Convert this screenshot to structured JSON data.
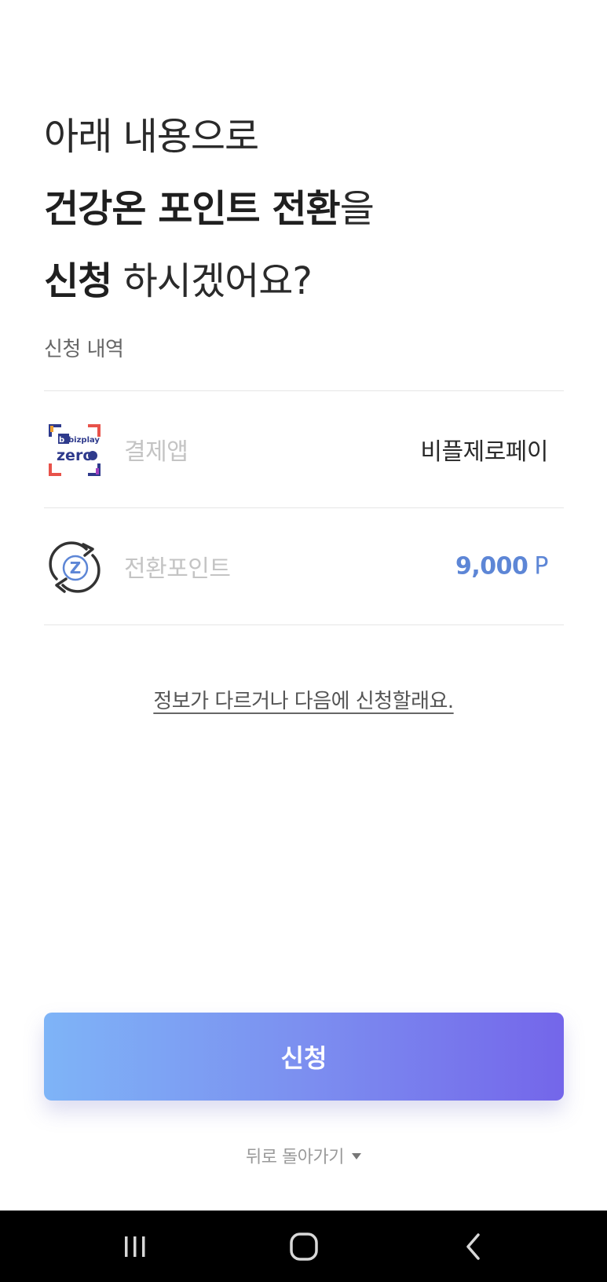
{
  "header": {
    "line1": "아래 내용으로",
    "line2_bold": "건강온 포인트 전환",
    "line2_suffix": "을",
    "line3_bold": "신청",
    "line3_suffix": " 하시겠어요?"
  },
  "details": {
    "section_label": "신청 내역",
    "rows": [
      {
        "label": "결제앱",
        "value": "비플제로페이",
        "icon": "bizplay-zero-logo-icon"
      },
      {
        "label": "전환포인트",
        "value": "9,000",
        "unit": "P",
        "icon": "point-exchange-icon"
      }
    ]
  },
  "alt_link": "정보가 다르거나 다음에 신청할래요.",
  "primary_button": "신청",
  "back_link": "뒤로 돌아가기",
  "nav_bar": {
    "recents": "recents-icon",
    "home": "home-icon",
    "back": "back-icon"
  },
  "logo_text": {
    "top": "bizplay",
    "bottom": "zero"
  },
  "colors": {
    "accent": "#5d86d6",
    "button_gradient_start": "#7eb4f7",
    "button_gradient_end": "#7466ea"
  }
}
